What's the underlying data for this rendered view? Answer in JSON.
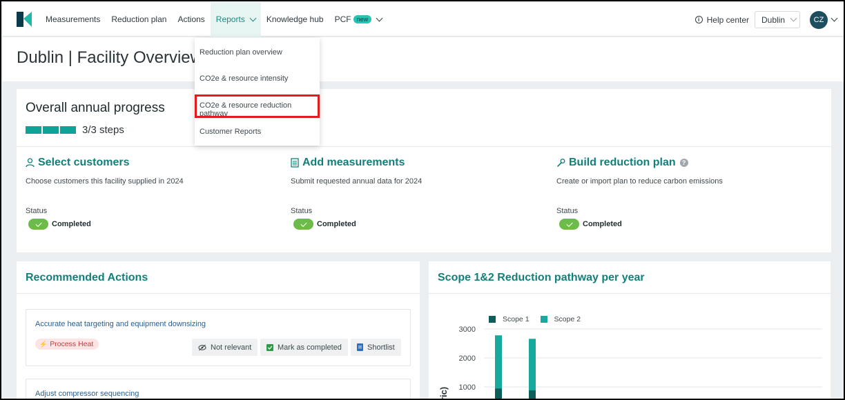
{
  "nav": {
    "items": [
      {
        "label": "Measurements"
      },
      {
        "label": "Reduction plan"
      },
      {
        "label": "Actions"
      },
      {
        "label": "Reports"
      },
      {
        "label": "Knowledge hub"
      },
      {
        "label": "PCF",
        "badge": "new"
      }
    ],
    "help_label": "Help center",
    "facility_select": "Dublin",
    "avatar_initials": "CZ",
    "accent_color": "#137f79"
  },
  "reports_menu": {
    "items": [
      {
        "label": "Reduction plan overview"
      },
      {
        "label": "CO2e & resource intensity"
      },
      {
        "label": "CO2e & resource reduction pathway"
      },
      {
        "label": "Customer Reports"
      }
    ],
    "highlighted_item": "CO2e & resource reduction pathway"
  },
  "page": {
    "title": "Dublin | Facility Overview"
  },
  "progress": {
    "title": "Overall annual progress",
    "steps_label": "3/3 steps",
    "steps_completed": 3,
    "steps_total": 3
  },
  "tasks": [
    {
      "title": "Select customers",
      "description": "Choose customers this facility supplied in 2024",
      "status_label": "Status",
      "status": "Completed",
      "icon": "user-icon"
    },
    {
      "title": "Add measurements",
      "description": "Submit requested annual data for 2024",
      "status_label": "Status",
      "status": "Completed",
      "icon": "document-icon"
    },
    {
      "title": "Build reduction plan",
      "description": "Create or import plan to reduce carbon emissions",
      "status_label": "Status",
      "status": "Completed",
      "icon": "wrench-icon",
      "help_icon": "?"
    }
  ],
  "recommended": {
    "title": "Recommended Actions",
    "actions": [
      {
        "title": "Accurate heat targeting and equipment downsizing",
        "tag": "Process Heat",
        "buttons": [
          "Not relevant",
          "Mark as completed",
          "Shortlist"
        ]
      },
      {
        "title": "Adjust compressor sequencing"
      }
    ]
  },
  "chart_panel": {
    "title": "Scope 1&2 Reduction pathway per year",
    "ylabel_visible": "ric)"
  },
  "chart_data": {
    "type": "bar",
    "stacked": true,
    "title": "Scope 1&2 Reduction pathway per year",
    "series": [
      {
        "name": "Scope 1",
        "color": "#0b5e5a",
        "values": [
          950,
          880
        ]
      },
      {
        "name": "Scope 2",
        "color": "#17a89e",
        "values": [
          1830,
          1780
        ]
      }
    ],
    "yticks": [
      1000,
      2000,
      3000
    ],
    "ylim": [
      0,
      3200
    ],
    "grid": true,
    "legend": "top"
  }
}
